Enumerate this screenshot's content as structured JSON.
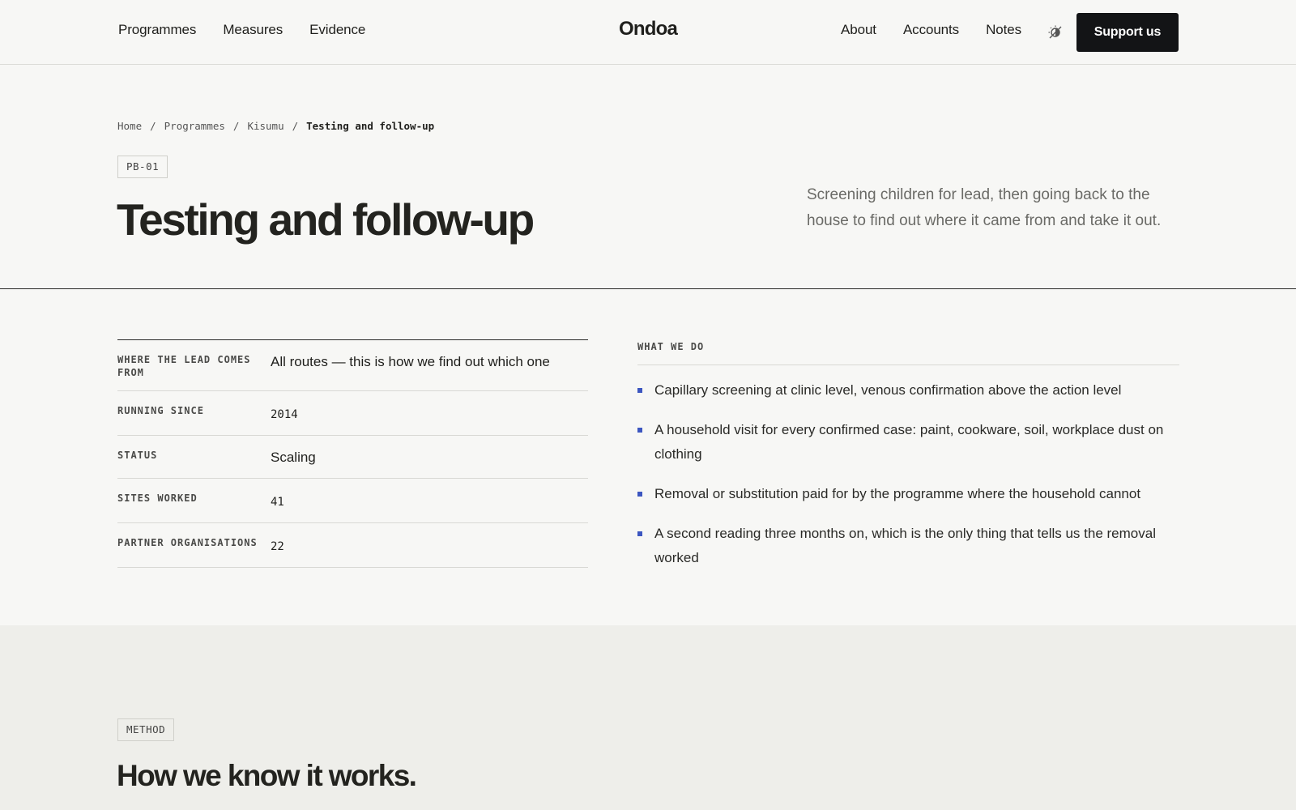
{
  "header": {
    "nav_left": [
      "Programmes",
      "Measures",
      "Evidence"
    ],
    "brand": "Ondoa",
    "nav_right": [
      "About",
      "Accounts",
      "Notes"
    ],
    "theme_icon": "theme-toggle-icon",
    "cta": "Support us"
  },
  "breadcrumb": {
    "items": [
      "Home",
      "Programmes",
      "Kisumu"
    ],
    "separator": "/",
    "current": "Testing and follow-up"
  },
  "hero": {
    "code": "PB-01",
    "title": "Testing and follow-up",
    "lede": "Screening children for lead, then going back to the house to find out where it came from and take it out."
  },
  "facts": [
    {
      "label": "Where the lead comes from",
      "value": "All routes — this is how we find out which one"
    },
    {
      "label": "Running since",
      "value": "2014"
    },
    {
      "label": "Status",
      "value": "Scaling"
    },
    {
      "label": "Sites worked",
      "value": "41"
    },
    {
      "label": "Partner organisations",
      "value": "22"
    }
  ],
  "what_we_do": {
    "heading": "WHAT WE DO",
    "items": [
      "Capillary screening at clinic level, venous confirmation above the action level",
      "A household visit for every confirmed case: paint, cookware, soil, workplace dust on clothing",
      "Removal or substitution paid for by the programme where the household cannot",
      "A second reading three months on, which is the only thing that tells us the removal worked"
    ],
    "bullet_color": "#3c56c0"
  },
  "method": {
    "tag": "METHOD",
    "title": "How we know it works."
  },
  "colors": {
    "background": "#f7f7f5",
    "band": "#eeeeea",
    "button": "#131416",
    "text": "#1f1f1c"
  }
}
